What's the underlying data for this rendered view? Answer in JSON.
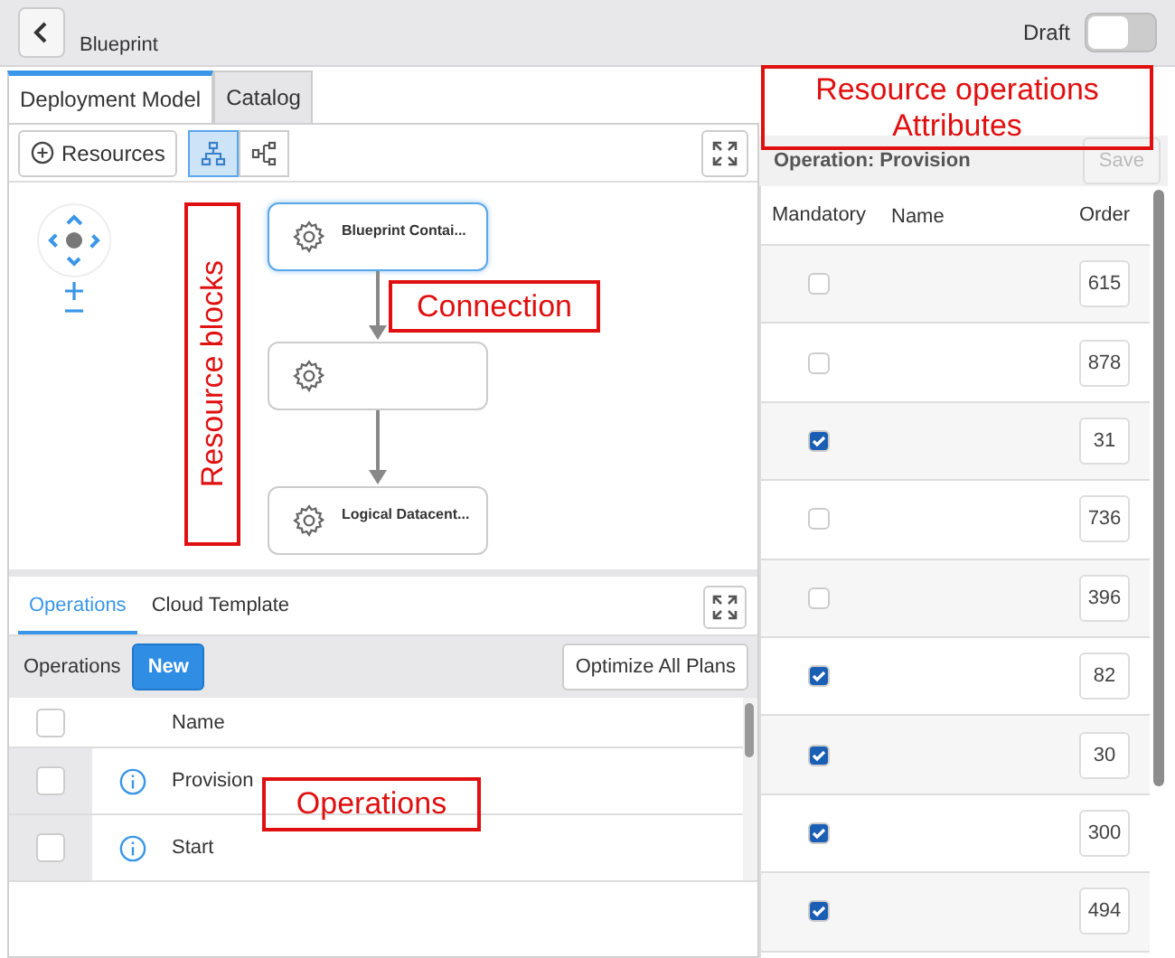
{
  "header": {
    "title": "Blueprint",
    "draft": {
      "label": "Draft",
      "on": false
    }
  },
  "tabs": [
    {
      "label": "Deployment Model",
      "selected": true
    },
    {
      "label": "Catalog",
      "selected": false
    }
  ],
  "toolbar": {
    "resources": "Resources",
    "views": [
      {
        "selected": true
      },
      {
        "selected": false
      }
    ]
  },
  "diagram": {
    "nodes": [
      {
        "label": "Blueprint Contai...",
        "selected": true
      },
      {
        "selected": false
      },
      {
        "label": "Logical Datacent...",
        "selected": false
      }
    ]
  },
  "bottom_tabs": [
    {
      "label": "Operations",
      "selected": true
    },
    {
      "label": "Cloud Template",
      "selected": false
    }
  ],
  "operations": {
    "label": "Operations",
    "new": "New",
    "optimize": "Optimize All Plans",
    "header_checked": false,
    "column": "Name",
    "rows": [
      {
        "name": "Provision",
        "checked": false
      },
      {
        "name": "Start",
        "checked": false
      }
    ]
  },
  "attributes": {
    "title": "Operation: Provision",
    "save": "Save",
    "columns": [
      "Mandatory",
      "Name",
      "Order"
    ],
    "rows": [
      {
        "mandatory": false,
        "order": "615"
      },
      {
        "mandatory": false,
        "order": "878"
      },
      {
        "mandatory": true,
        "order": "31"
      },
      {
        "mandatory": false,
        "order": "736"
      },
      {
        "mandatory": false,
        "order": "396"
      },
      {
        "mandatory": true,
        "order": "82"
      },
      {
        "mandatory": true,
        "order": "30"
      },
      {
        "mandatory": true,
        "order": "300"
      },
      {
        "mandatory": true,
        "order": "494"
      }
    ]
  },
  "annotations": [
    {
      "text": "Resource operations Attributes",
      "kind": "box"
    },
    {
      "text": "Resource blocks",
      "kind": "vertical"
    },
    {
      "text": "Connection",
      "kind": "box"
    },
    {
      "text": "Operations",
      "kind": "box"
    }
  ]
}
